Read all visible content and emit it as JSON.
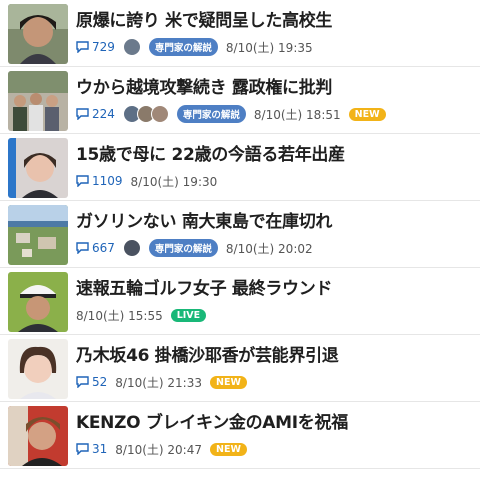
{
  "colors": {
    "comment_icon": "#1f64b8",
    "expert_badge": "#4e7fc4",
    "new_badge": "#f2b318",
    "live_badge": "#19b878"
  },
  "articles": [
    {
      "title": "原爆に誇り 米で疑問呈した高校生",
      "comments": "729",
      "expert_label": "専門家の解説",
      "date": "8/10(土) 19:35"
    },
    {
      "title": "ウから越境攻撃続き 露政権に批判",
      "comments": "224",
      "expert_label": "専門家の解説",
      "date": "8/10(土) 18:51",
      "new_label": "NEW"
    },
    {
      "title": "15歳で母に 22歳の今語る若年出産",
      "comments": "1109",
      "date": "8/10(土) 19:30"
    },
    {
      "title": "ガソリンない 南大東島で在庫切れ",
      "comments": "667",
      "expert_label": "専門家の解説",
      "date": "8/10(土) 20:02"
    },
    {
      "title": "速報五輪ゴルフ女子 最終ラウンド",
      "date": "8/10(土) 15:55",
      "live_label": "LIVE"
    },
    {
      "title": "乃木坂46 掛橋沙耶香が芸能界引退",
      "comments": "52",
      "date": "8/10(土) 21:33",
      "new_label": "NEW"
    },
    {
      "title": "KENZO ブレイキン金のAMIを祝福",
      "comments": "31",
      "date": "8/10(土) 20:47",
      "new_label": "NEW"
    }
  ]
}
